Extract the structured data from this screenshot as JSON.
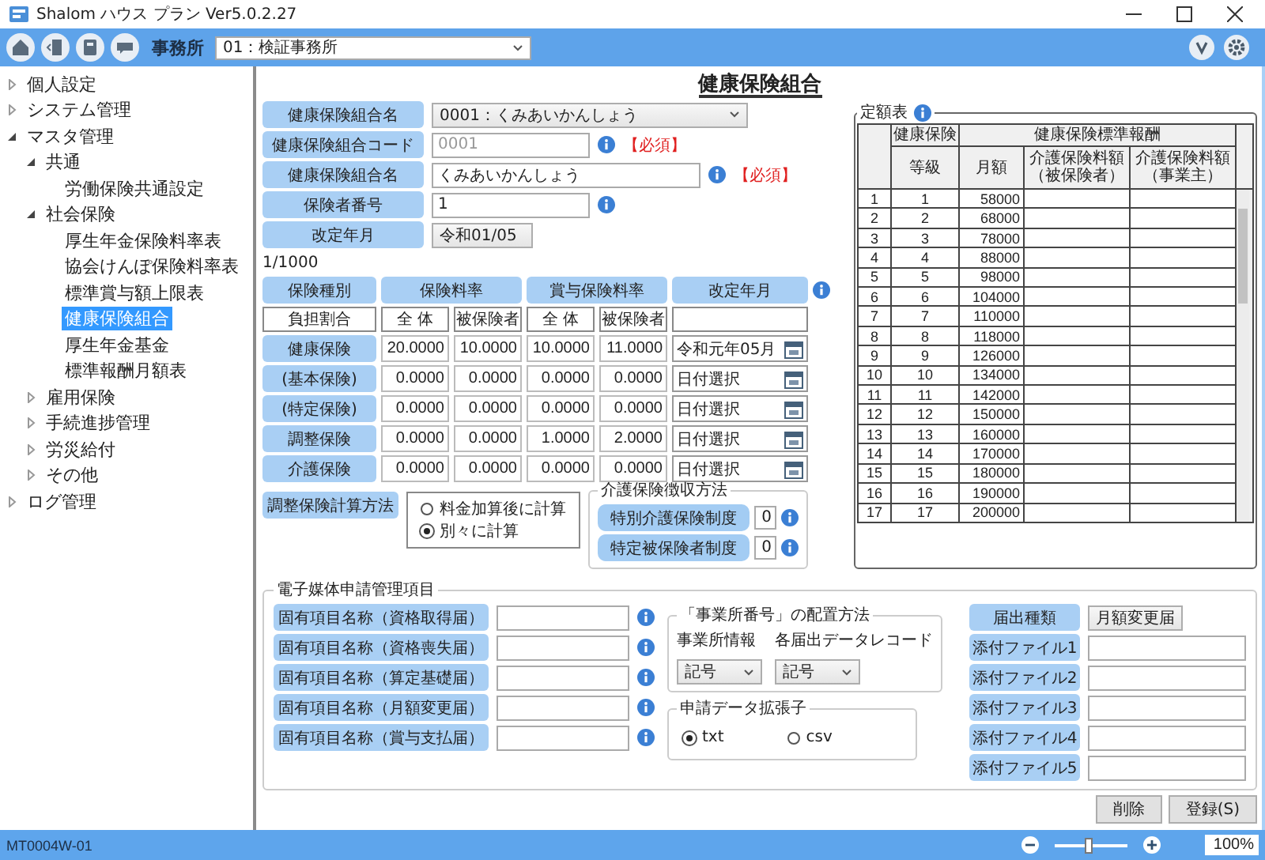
{
  "window": {
    "title": "Shalom ハウス プラン Ver5.0.2.27"
  },
  "toolbar": {
    "office_label": "事務所",
    "office_value": "01：検証事務所"
  },
  "sidebar": {
    "items": [
      {
        "label": "個人設定",
        "expanded": false,
        "selected": false
      },
      {
        "label": "システム管理",
        "expanded": false,
        "selected": false
      },
      {
        "label": "マスタ管理",
        "expanded": true,
        "selected": false,
        "children": [
          {
            "label": "共通",
            "expanded": true,
            "selected": false,
            "children": [
              {
                "label": "労働保険共通設定",
                "selected": false
              }
            ]
          },
          {
            "label": "社会保険",
            "expanded": true,
            "selected": false,
            "children": [
              {
                "label": "厚生年金保険料率表",
                "selected": false
              },
              {
                "label": "協会けんぽ保険料率表",
                "selected": false
              },
              {
                "label": "標準賞与額上限表",
                "selected": false
              },
              {
                "label": "健康保険組合",
                "selected": true
              },
              {
                "label": "厚生年金基金",
                "selected": false
              },
              {
                "label": "標準報酬月額表",
                "selected": false
              }
            ]
          },
          {
            "label": "雇用保険",
            "expanded": false,
            "selected": false
          },
          {
            "label": "手続進捗管理",
            "expanded": false,
            "selected": false
          },
          {
            "label": "労災給付",
            "expanded": false,
            "selected": false
          },
          {
            "label": "その他",
            "expanded": false,
            "selected": false
          }
        ]
      },
      {
        "label": "ログ管理",
        "expanded": false,
        "selected": false
      }
    ]
  },
  "page_title": "健康保険組合",
  "form": {
    "fields": [
      {
        "label": "健康保険組合名",
        "kind": "select",
        "value": "0001：くみあいかんしょう"
      },
      {
        "label": "健康保険組合コード",
        "kind": "input",
        "value": "0001",
        "disabled": true,
        "info": true,
        "required": "【必須】"
      },
      {
        "label": "健康保険組合名",
        "kind": "input",
        "value": "くみあいかんしょう",
        "disabled": false,
        "info": true,
        "required": "【必須】"
      },
      {
        "label": "保険者番号",
        "kind": "input",
        "value": "1",
        "disabled": false,
        "info": true
      },
      {
        "label": "改定年月",
        "kind": "select",
        "value": "令和01/05"
      }
    ]
  },
  "record_count": "1/1000",
  "rates": {
    "headers": [
      "保険種別",
      "保険料率",
      "賞与保険料率",
      "改定年月"
    ],
    "subheaders": [
      "負担割合",
      "全 体",
      "被保険者",
      "全 体",
      "被保険者"
    ],
    "rows": [
      {
        "label": "健康保険",
        "values": [
          "20.0000",
          "10.0000",
          "10.0000",
          "11.0000"
        ],
        "date": "令和元年05月"
      },
      {
        "label": "(基本保険)",
        "values": [
          "0.0000",
          "0.0000",
          "0.0000",
          "0.0000"
        ],
        "date": "日付選択"
      },
      {
        "label": "(特定保険)",
        "values": [
          "0.0000",
          "0.0000",
          "0.0000",
          "0.0000"
        ],
        "date": "日付選択"
      },
      {
        "label": "調整保険",
        "values": [
          "0.0000",
          "0.0000",
          "1.0000",
          "2.0000"
        ],
        "date": "日付選択"
      },
      {
        "label": "介護保険",
        "values": [
          "0.0000",
          "0.0000",
          "0.0000",
          "0.0000"
        ],
        "date": "日付選択"
      }
    ]
  },
  "adjust": {
    "label": "調整保険計算方法",
    "options": [
      {
        "label": "料金加算後に計算",
        "selected": false
      },
      {
        "label": "別々に計算",
        "selected": true
      }
    ]
  },
  "care": {
    "legend": "介護保険徴収方法",
    "rows": [
      {
        "label": "特別介護保険制度",
        "value": "0"
      },
      {
        "label": "特定被保険者制度",
        "value": "0"
      }
    ]
  },
  "grade_table": {
    "legend": "定額表",
    "group_headers": [
      "健康保険",
      "健康保険標準報酬"
    ],
    "columns": [
      [
        "等級"
      ],
      [
        "月額"
      ],
      [
        "介護保険料額",
        "（被保険者）"
      ],
      [
        "介護保険料額",
        "（事業主）"
      ]
    ],
    "rows": [
      {
        "no": "1",
        "grade": "1",
        "amount": "58000"
      },
      {
        "no": "2",
        "grade": "2",
        "amount": "68000"
      },
      {
        "no": "3",
        "grade": "3",
        "amount": "78000"
      },
      {
        "no": "4",
        "grade": "4",
        "amount": "88000"
      },
      {
        "no": "5",
        "grade": "5",
        "amount": "98000"
      },
      {
        "no": "6",
        "grade": "6",
        "amount": "104000"
      },
      {
        "no": "7",
        "grade": "7",
        "amount": "110000"
      },
      {
        "no": "8",
        "grade": "8",
        "amount": "118000"
      },
      {
        "no": "9",
        "grade": "9",
        "amount": "126000"
      },
      {
        "no": "10",
        "grade": "10",
        "amount": "134000"
      },
      {
        "no": "11",
        "grade": "11",
        "amount": "142000"
      },
      {
        "no": "12",
        "grade": "12",
        "amount": "150000"
      },
      {
        "no": "13",
        "grade": "13",
        "amount": "160000"
      },
      {
        "no": "14",
        "grade": "14",
        "amount": "170000"
      },
      {
        "no": "15",
        "grade": "15",
        "amount": "180000"
      },
      {
        "no": "16",
        "grade": "16",
        "amount": "190000"
      },
      {
        "no": "17",
        "grade": "17",
        "amount": "200000"
      }
    ]
  },
  "electronic": {
    "legend": "電子媒体申請管理項目",
    "fields": [
      "固有項目名称（資格取得届）",
      "固有項目名称（資格喪失届）",
      "固有項目名称（算定基礎届）",
      "固有項目名称（月額変更届）",
      "固有項目名称（賞与支払届）"
    ],
    "placement": {
      "legend": "「事業所番号」の配置方法",
      "columns": [
        {
          "label": "事業所情報",
          "value": "記号"
        },
        {
          "label": "各届出データレコード",
          "value": "記号"
        }
      ]
    },
    "extension": {
      "legend": "申請データ拡張子",
      "options": [
        {
          "label": "txt",
          "selected": true
        },
        {
          "label": "csv",
          "selected": false
        }
      ]
    },
    "notification": {
      "label": "届出種類",
      "value": "月額変更届"
    },
    "attachments": [
      "添付ファイル1",
      "添付ファイル2",
      "添付ファイル3",
      "添付ファイル4",
      "添付ファイル5"
    ]
  },
  "buttons": [
    "削除",
    "登録(S)"
  ],
  "status_bar": {
    "code": "MT0004W-01",
    "zoom": {
      "level": 0.47
    },
    "zoom_value": "100%"
  }
}
